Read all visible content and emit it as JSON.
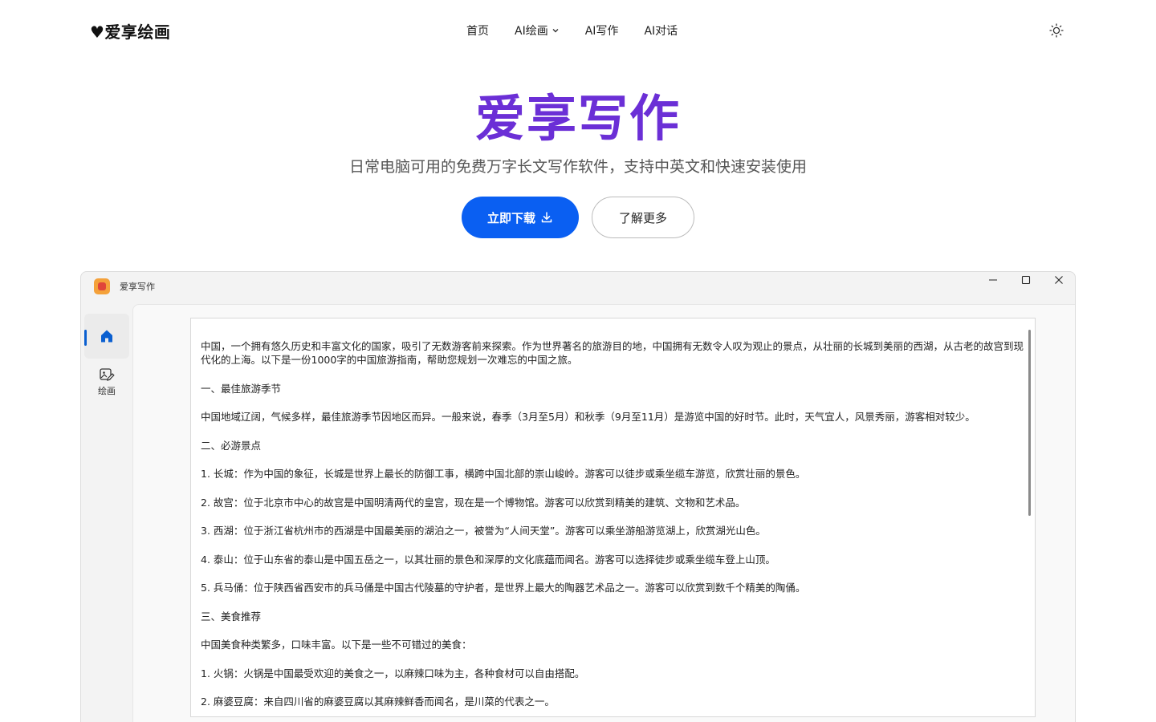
{
  "nav": {
    "logo": "♥爱享绘画",
    "items": [
      {
        "label": "首页",
        "has_dropdown": false
      },
      {
        "label": "AI绘画",
        "has_dropdown": true
      },
      {
        "label": "AI写作",
        "has_dropdown": false
      },
      {
        "label": "AI对话",
        "has_dropdown": false
      }
    ],
    "theme_icon": "sun-icon"
  },
  "hero": {
    "title": "爱享写作",
    "subtitle": "日常电脑可用的免费万字长文写作软件，支持中英文和快速安装使用",
    "primary_button": "立即下载",
    "secondary_button": "了解更多"
  },
  "window": {
    "title": "爱享写作",
    "sidebar": {
      "home_icon": "home-icon",
      "draw_label": "绘画"
    },
    "document": [
      "中国，一个拥有悠久历史和丰富文化的国家，吸引了无数游客前来探索。作为世界著名的旅游目的地，中国拥有无数令人叹为观止的景点，从壮丽的长城到美丽的西湖，从古老的故宫到现代化的上海。以下是一份1000字的中国旅游指南，帮助您规划一次难忘的中国之旅。",
      "一、最佳旅游季节",
      "中国地域辽阔，气候多样，最佳旅游季节因地区而异。一般来说，春季（3月至5月）和秋季（9月至11月）是游览中国的好时节。此时，天气宜人，风景秀丽，游客相对较少。",
      "二、必游景点",
      "1. 长城：作为中国的象征，长城是世界上最长的防御工事，横跨中国北部的崇山峻岭。游客可以徒步或乘坐缆车游览，欣赏壮丽的景色。",
      "2. 故宫：位于北京市中心的故宫是中国明清两代的皇宫，现在是一个博物馆。游客可以欣赏到精美的建筑、文物和艺术品。",
      "3. 西湖：位于浙江省杭州市的西湖是中国最美丽的湖泊之一，被誉为“人间天堂”。游客可以乘坐游船游览湖上，欣赏湖光山色。",
      "4. 泰山：位于山东省的泰山是中国五岳之一，以其壮丽的景色和深厚的文化底蕴而闻名。游客可以选择徒步或乘坐缆车登上山顶。",
      "5. 兵马俑：位于陕西省西安市的兵马俑是中国古代陵墓的守护者，是世界上最大的陶器艺术品之一。游客可以欣赏到数千个精美的陶俑。",
      "三、美食推荐",
      "中国美食种类繁多，口味丰富。以下是一些不可错过的美食：",
      "1. 火锅：火锅是中国最受欢迎的美食之一，以麻辣口味为主，各种食材可以自由搭配。",
      "2. 麻婆豆腐：来自四川省的麻婆豆腐以其麻辣鲜香而闻名，是川菜的代表之一。"
    ]
  },
  "colors": {
    "hero_title": "#6b2fd6",
    "primary_button": "#0a5ff2",
    "carousel_arrow": "#1a5fe0"
  }
}
